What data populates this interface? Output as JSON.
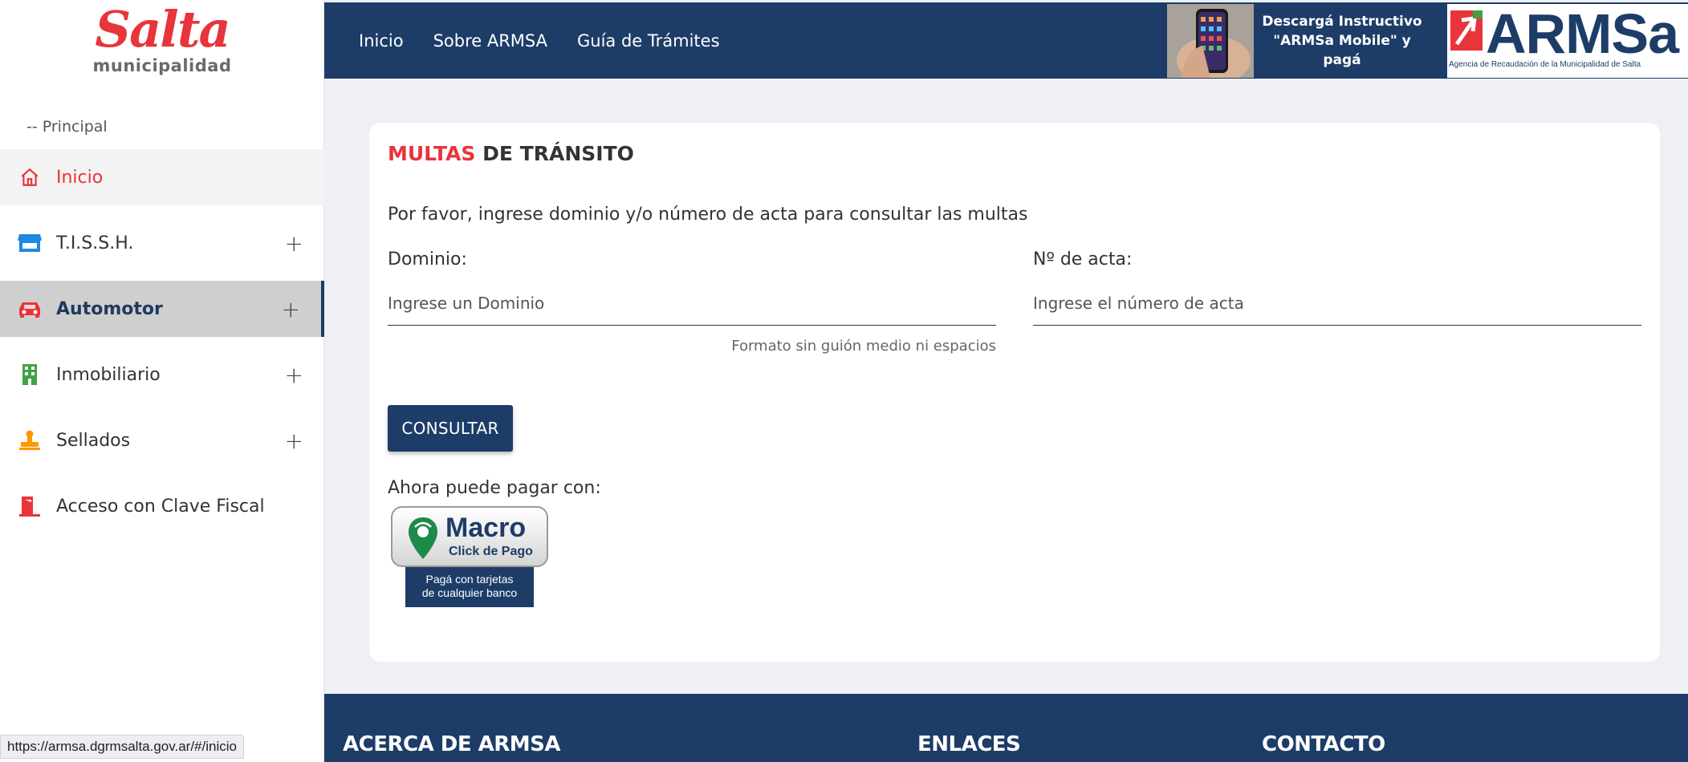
{
  "sidebar": {
    "logo": {
      "brand": "Salta",
      "subtitle": "municipalidad"
    },
    "section_label": "-- Principal",
    "items": [
      {
        "label": "Inicio",
        "icon": "home-icon"
      },
      {
        "label": "T.I.S.S.H.",
        "icon": "store-icon"
      },
      {
        "label": "Automotor",
        "icon": "car-icon"
      },
      {
        "label": "Inmobiliario",
        "icon": "building-icon"
      },
      {
        "label": "Sellados",
        "icon": "stamp-icon"
      },
      {
        "label": "Acceso con Clave Fiscal",
        "icon": "door-exit-icon"
      }
    ],
    "expand_symbol": "+"
  },
  "header": {
    "nav": [
      "Inicio",
      "Sobre ARMSA",
      "Guía de Trámites"
    ],
    "promo_line1": "Descargá Instructivo",
    "promo_line2": "\"ARMSa Mobile\" y pagá",
    "logo_text": "ARMSa",
    "logo_subtext": "Agencia de Recaudación de la Municipalidad de Salta"
  },
  "main": {
    "title_highlight": "MULTAS",
    "title_rest": "DE TRÁNSITO",
    "intro": "Por favor, ingrese dominio y/o número de acta para consultar las multas",
    "dominio_label": "Dominio:",
    "dominio_placeholder": "Ingrese un Dominio",
    "dominio_hint": "Formato sin guión medio ni espacios",
    "acta_label": "Nº de acta:",
    "acta_placeholder": "Ingrese el número de acta",
    "submit_label": "CONSULTAR",
    "pay_label": "Ahora puede pagar con:",
    "macro": {
      "name": "Macro",
      "sub": "Click de Pago",
      "line1": "Pagá con tarjetas",
      "line2": "de cualquier banco"
    }
  },
  "footer": {
    "col1": "ACERCA DE ARMSA",
    "col2": "ENLACES",
    "col3": "CONTACTO"
  },
  "status_bar": {
    "url": "https://armsa.dgrmsalta.gov.ar/#/inicio"
  },
  "colors": {
    "primary": "#1d3d68",
    "accent_red": "#e8343b",
    "background": "#eff0f5"
  }
}
